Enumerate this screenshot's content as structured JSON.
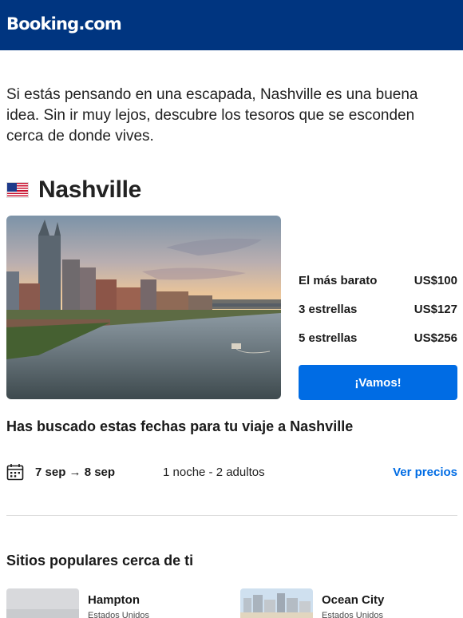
{
  "header": {
    "logo": "Booking.com"
  },
  "intro": "Si estás pensando en una escapada, Nashville es una buena idea. Sin ir muy lejos, descubre los tesoros que se esconden cerca de donde vives.",
  "destination": {
    "flag_icon": "us-flag-icon",
    "name": "Nashville"
  },
  "prices": [
    {
      "label": "El más barato",
      "value": "US$100"
    },
    {
      "label": "3 estrellas",
      "value": "US$127"
    },
    {
      "label": "5 estrellas",
      "value": "US$256"
    }
  ],
  "cta_label": "¡Vamos!",
  "search": {
    "title": "Has buscado estas fechas para tu viaje a Nashville",
    "calendar_icon": "calendar-icon",
    "dates": "7 sep → 8 sep",
    "guests": "1 noche - 2 adultos",
    "link": "Ver precios"
  },
  "popular": {
    "title": "Sitios populares cerca de ti",
    "places": [
      {
        "name": "Hampton",
        "country": "Estados Unidos"
      },
      {
        "name": "Ocean City",
        "country": "Estados Unidos"
      }
    ]
  },
  "colors": {
    "brand_blue": "#003580",
    "action_blue": "#006ce4"
  }
}
